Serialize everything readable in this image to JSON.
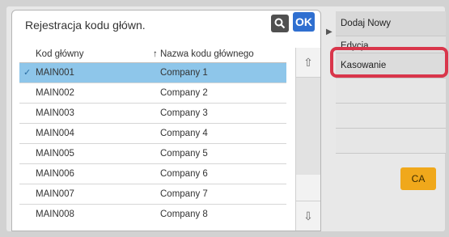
{
  "header": {
    "title": "Rejestracja kodu główn.",
    "ok_label": "OK"
  },
  "table": {
    "col_code": "Kod główny",
    "col_name_marker": "↑",
    "col_name": "Nazwa kodu głównego",
    "rows": [
      {
        "code": "MAIN001",
        "name": "Company 1"
      },
      {
        "code": "MAIN002",
        "name": "Company 2"
      },
      {
        "code": "MAIN003",
        "name": "Company 3"
      },
      {
        "code": "MAIN004",
        "name": "Company 4"
      },
      {
        "code": "MAIN005",
        "name": "Company 5"
      },
      {
        "code": "MAIN006",
        "name": "Company 6"
      },
      {
        "code": "MAIN007",
        "name": "Company 7"
      },
      {
        "code": "MAIN008",
        "name": "Company 8"
      }
    ],
    "selected_index": 0
  },
  "sidebar": {
    "add_new": "Dodaj Nowy",
    "edit": "Edycja",
    "delete": "Kasowanie"
  },
  "ca_label": "CA",
  "colors": {
    "ok": "#2f6fd0",
    "selected_row": "#8ec6ea",
    "highlight": "#d9364b",
    "ca": "#f0a81b"
  },
  "icons": [
    "search-icon",
    "scroll-up-icon",
    "scroll-down-icon",
    "checkmark-icon",
    "sort-arrow-icon",
    "expand-arrow-icon"
  ]
}
